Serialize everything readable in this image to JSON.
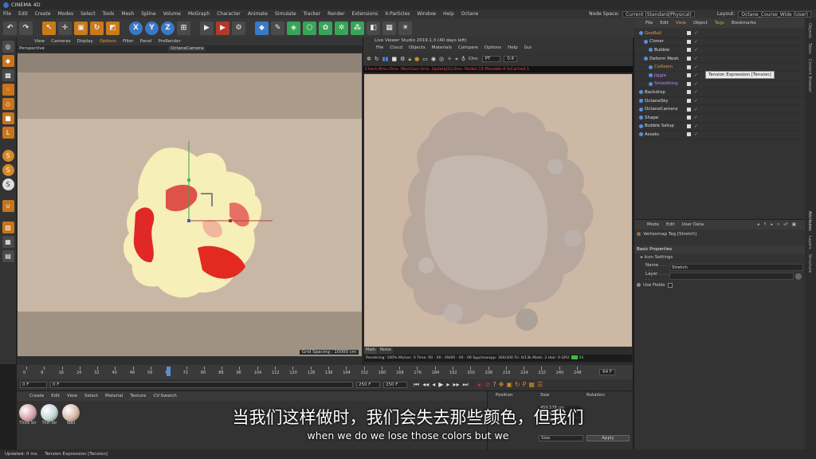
{
  "app": {
    "title": "CINEMA 4D"
  },
  "menu": {
    "items": [
      "File",
      "Edit",
      "Create",
      "Modes",
      "Select",
      "Tools",
      "Mesh",
      "Spline",
      "Volume",
      "MoGraph",
      "Character",
      "Animate",
      "Simulate",
      "Tracker",
      "Render",
      "Extensions",
      "X-Particles",
      "Window",
      "Help",
      "Octane"
    ],
    "node_space_label": "Node Space:",
    "node_space_value": "Current (Standard/Physical)",
    "layout_label": "Layout:",
    "layout_value": "Octane_Course_Wide (User)"
  },
  "viewport1": {
    "menu": [
      "View",
      "Cameras",
      "Display",
      "Options",
      "Filter",
      "Panel",
      "ProRender"
    ],
    "name": "Perspective",
    "camera": "OctaneCamera",
    "grid_spacing": "Grid Spacing : 10000 cm"
  },
  "viewport2": {
    "title": "Live Viewer Studio 2019.1.3 (40 days left)",
    "menu": [
      "File",
      "Cloud",
      "Objects",
      "Materials",
      "Compare",
      "Options",
      "Help",
      "Gui"
    ],
    "chn_label": "Chn:",
    "chn_value": "PT",
    "chn_num": "0.6",
    "status": "Check:8ms./0ms. MeshGen:0ms. Update[G]:0ms. Nodes:19 Movable:4 txCached:1",
    "tabs": [
      "Main",
      "Noise"
    ],
    "stats": "Rendering: 100% Ms/sec: 0   Time: 00 : 00 : 09/00 : 00 : 09  Spp/maxspp: 300/300  Tri: 0/13k  Mesh: 2  Hair: 0   GPU:",
    "gpu_value": "56"
  },
  "object_manager": {
    "menu": [
      "File",
      "Edit",
      "View",
      "Object",
      "Tags",
      "Bookmarks"
    ],
    "objects": [
      {
        "name": "GeoBall",
        "indent": 0,
        "color": "#e59a3a"
      },
      {
        "name": "Cloner",
        "indent": 1,
        "color": "#dddddd"
      },
      {
        "name": "Bubble",
        "indent": 2,
        "color": "#dddddd"
      },
      {
        "name": "Deform Mesh",
        "indent": 1,
        "color": "#dddddd"
      },
      {
        "name": "Collision",
        "indent": 2,
        "color": "#e59a3a"
      },
      {
        "name": "Jiggle",
        "indent": 2,
        "color": "#b78cf0"
      },
      {
        "name": "Smoothing",
        "indent": 2,
        "color": "#b78cf0"
      },
      {
        "name": "Backdrop",
        "indent": 0,
        "color": "#dddddd"
      },
      {
        "name": "OctaneSky",
        "indent": 0,
        "color": "#dddddd"
      },
      {
        "name": "OctaneCamera",
        "indent": 0,
        "color": "#dddddd"
      },
      {
        "name": "Shape",
        "indent": 0,
        "color": "#dddddd"
      },
      {
        "name": "Bubble Setup",
        "indent": 0,
        "color": "#dddddd"
      },
      {
        "name": "Assets",
        "indent": 0,
        "color": "#dddddd"
      }
    ],
    "tooltip": "Tension Expression [Tension]"
  },
  "attributes": {
    "menu": [
      "Mode",
      "Edit",
      "User Data"
    ],
    "tag_title": "Vertexmap Tag [Stretch]",
    "section": "Basic Properties",
    "icon_settings": "Icon Settings",
    "name_label": "Name . . . . . .",
    "name_value": "Stretch",
    "layer_label": "Layer . . . . . .",
    "use_fields": "Use Fields"
  },
  "side_tabs": [
    "Objects",
    "Takes",
    "Content Browser",
    "Attributes",
    "Layers",
    "Structure"
  ],
  "timeline": {
    "ticks": [
      "0",
      "8",
      "16",
      "24",
      "32",
      "40",
      "48",
      "56",
      "64",
      "72",
      "80",
      "88",
      "96",
      "104",
      "112",
      "120",
      "128",
      "136",
      "144",
      "152",
      "160",
      "168",
      "176",
      "184",
      "192",
      "200",
      "208",
      "216",
      "224",
      "232",
      "240",
      "248"
    ],
    "current_frame": "64 F",
    "playhead": 64,
    "max_frame": 248
  },
  "transport": {
    "start": "0 F",
    "current": "0 F",
    "end1": "250 F",
    "end2": "250 F"
  },
  "materials": {
    "menu": [
      "Create",
      "Edit",
      "View",
      "Select",
      "Material",
      "Texture",
      "CV-Swatch"
    ],
    "items": [
      {
        "label": "Thick Str",
        "color": "#d7a0aa"
      },
      {
        "label": "Thin Str",
        "color": "#c5d4d8"
      },
      {
        "label": "Wall",
        "color": "#d8b8a4"
      }
    ]
  },
  "coordinates": {
    "headers": [
      "Position",
      "Size",
      "Rotation"
    ],
    "size_values": [
      "459.578 cm",
      "459.578 cm",
      "459.578 cm"
    ],
    "mode": "Size",
    "apply": "Apply"
  },
  "status": {
    "text": "Updated: 0 ms.",
    "tag": "Tension Expression [Tension]"
  },
  "subtitles": {
    "zh": "当我们这样做时，我们会失去那些颜色，但我们",
    "en": "when we do we lose those colors but we"
  }
}
